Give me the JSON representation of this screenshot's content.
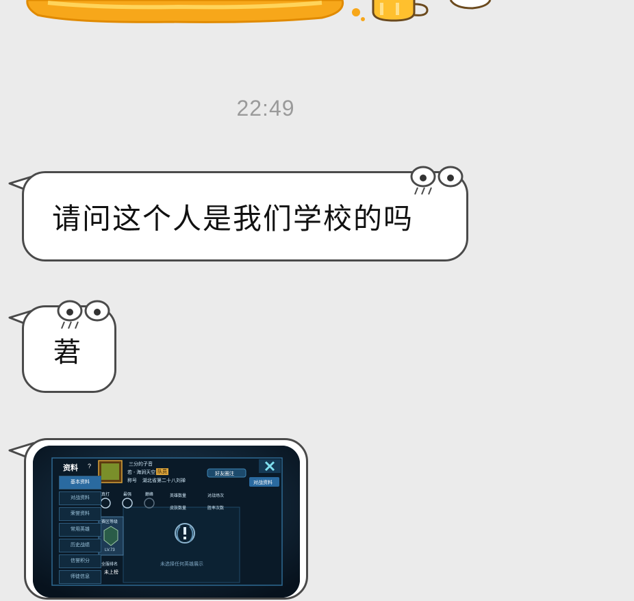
{
  "chat": {
    "timestamp": "22:49",
    "messages": [
      {
        "type": "text",
        "text": "请问这个人是我们学校的吗"
      },
      {
        "type": "text",
        "text": "莙"
      },
      {
        "type": "image"
      }
    ]
  },
  "game_screenshot": {
    "title": "资料",
    "help": "?",
    "close_icon": "close-x-icon",
    "sidebar": [
      "基本资料",
      "对战资料",
      "荣誉资料",
      "常用英雄",
      "历史战绩",
      "信誉积分",
      "师徒信息"
    ],
    "player": {
      "name": "三分的子音",
      "region": "若 - 海涧天空",
      "badge": "队员",
      "title_label": "称号",
      "title_value": "湖北省第二十八刘禅"
    },
    "follow_button": "好友圈注",
    "nav_button": "对战资料",
    "stat_labels": [
      "英雄数量",
      "对战场次",
      "皮肤数量",
      "胜率次数"
    ],
    "rank_labels": [
      "真打",
      "最强",
      "巅峰"
    ],
    "level_label": "赛区等级",
    "level": "LV.73",
    "rank_label": "全服排名",
    "rank_value": "未上榜",
    "empty_message": "未选择任何英雄展示"
  },
  "colors": {
    "background": "#ebebeb",
    "bubble_border": "#4a4a4a",
    "timestamp": "#9a9a9a",
    "sticker": "#f7a71a"
  }
}
